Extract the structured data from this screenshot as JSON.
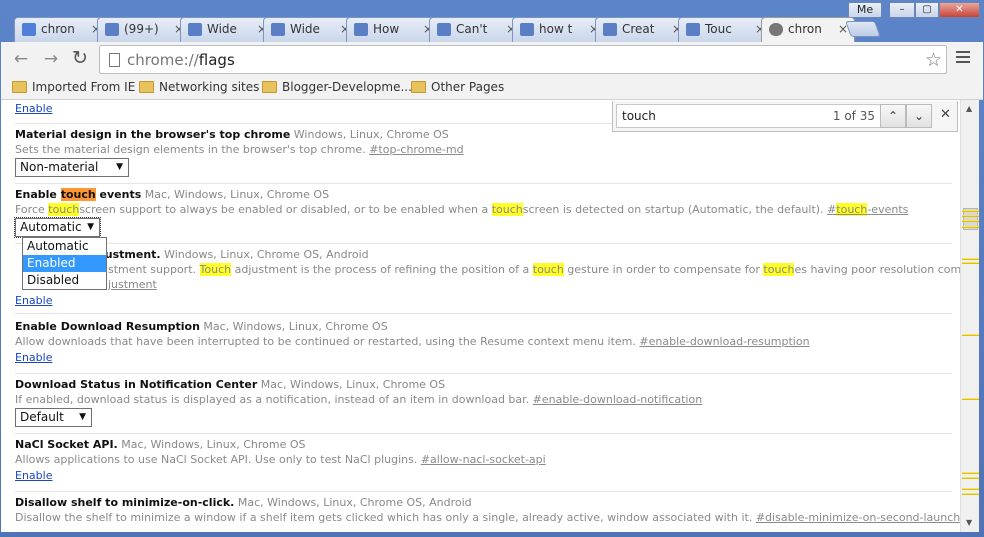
{
  "window": {
    "profile": "Me",
    "min": "–",
    "max": "▢",
    "close": "✕"
  },
  "tabs": [
    {
      "label": "chron",
      "icon": "google-icon",
      "color": "#4f7fd9"
    },
    {
      "label": "(99+)",
      "icon": "forum-icon",
      "color": "#5b7fc5"
    },
    {
      "label": "Wide",
      "icon": "forum-icon",
      "color": "#5b7fc5"
    },
    {
      "label": "Wide",
      "icon": "forum-icon",
      "color": "#5b7fc5"
    },
    {
      "label": "How",
      "icon": "forum-icon",
      "color": "#5b7fc5"
    },
    {
      "label": "Can't",
      "icon": "forum-icon",
      "color": "#5b7fc5"
    },
    {
      "label": "how t",
      "icon": "forum-icon",
      "color": "#5b7fc5"
    },
    {
      "label": "Creat",
      "icon": "forum-icon",
      "color": "#5b7fc5"
    },
    {
      "label": "Touc",
      "icon": "forum-icon",
      "color": "#5b7fc5"
    },
    {
      "label": "chron",
      "icon": "radiation-icon",
      "color": "#666666",
      "active": true
    }
  ],
  "toolbar": {
    "back": "←",
    "forward": "→",
    "reload": "↻",
    "url_scheme": "chrome://",
    "url_path": "flags",
    "star": "☆"
  },
  "bookmarks": [
    {
      "label": "Imported From IE"
    },
    {
      "label": "Networking sites"
    },
    {
      "label": "Blogger-Developme..."
    },
    {
      "label": "Other Pages"
    }
  ],
  "findbar": {
    "query": "touch",
    "count": "1 of 35",
    "prev": "⌃",
    "next": "⌄",
    "close": "✕"
  },
  "experiments": {
    "top_link": "Enable",
    "md": {
      "name": "Material design in the browser's top chrome",
      "platforms": "Windows, Linux, Chrome OS",
      "desc": "Sets the material design elements in the browser's top chrome.",
      "anchor": "#top-chrome-md",
      "select": "Non-material"
    },
    "touch_events": {
      "name_pre": "Enable ",
      "name_hl": "touch",
      "name_post": " events",
      "platforms": "Mac, Windows, Linux, Chrome OS",
      "d1": "Force ",
      "d1_hl": "touch",
      "d2": "screen support to always be enabled or disabled, or to be enabled when a ",
      "d2_hl": "touch",
      "d3": "screen is detected on startup (Automatic, the default).",
      "anchor_pre": "#",
      "anchor_hl": "touch",
      "anchor_post": "-events",
      "select": "Automatic",
      "options": [
        "Automatic",
        "Enabled",
        "Disabled"
      ]
    },
    "touch_adjust": {
      "name_tail": "justment.",
      "platforms": "Windows, Linux, Chrome OS, Android",
      "d0": "ustment support.",
      "d1_hl": "Touch",
      "d2": " adjustment is the process of refining the position of a ",
      "d2_hl": "touch",
      "d3": " gesture in order to compensate for ",
      "d3_hl": "touch",
      "d4": "es having poor resolution compared to a mouse.",
      "anchor_tail": "djustment",
      "link": "Enable"
    },
    "download_resume": {
      "name": "Enable Download Resumption",
      "platforms": "Mac, Windows, Linux, Chrome OS",
      "desc": "Allow downloads that have been interrupted to be continued or restarted, using the Resume context menu item.",
      "anchor": "#enable-download-resumption",
      "link": "Enable"
    },
    "download_notif": {
      "name": "Download Status in Notification Center",
      "platforms": "Mac, Windows, Linux, Chrome OS",
      "desc": "If enabled, download status is displayed as a notification, instead of an item in download bar.",
      "anchor": "#enable-download-notification",
      "select": "Default"
    },
    "nacl": {
      "name": "NaCl Socket API.",
      "platforms": "Mac, Windows, Linux, Chrome OS",
      "desc": "Allows applications to use NaCl Socket API. Use only to test NaCl plugins.",
      "anchor": "#allow-nacl-socket-api",
      "link": "Enable"
    },
    "shelf": {
      "name": "Disallow shelf to minimize-on-click.",
      "platforms": "Mac, Windows, Linux, Chrome OS, Android",
      "desc": "Disallow the shelf to minimize a window if a shelf item gets clicked which has only a single, already active, window associated with it.",
      "anchor": "#disable-minimize-on-second-launcher-item-click"
    }
  },
  "scroll_up": "▲",
  "scroll_down": "▼",
  "colors": {
    "highlight": "#ffff26",
    "active_match": "#ff9632",
    "link": "#1a46c2",
    "selected_option": "#3399ff"
  }
}
